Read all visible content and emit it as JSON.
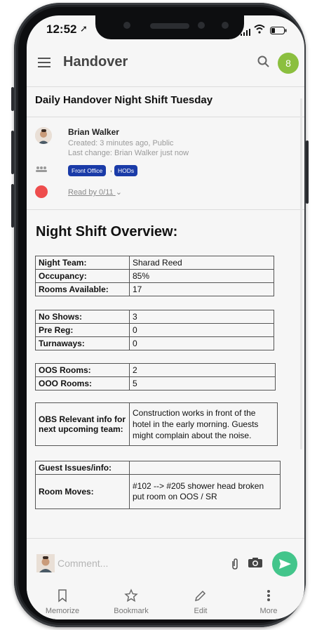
{
  "status": {
    "time": "12:52",
    "signal": "..ll ≋"
  },
  "appbar": {
    "title": "Handover",
    "badge": "8"
  },
  "document": {
    "title": "Daily Handover Night Shift Tuesday",
    "author": "Brian Walker",
    "created": "Created: 3 minutes ago, Public",
    "last_change": "Last change: Brian Walker just now",
    "tags": [
      "Front Office",
      "HODs"
    ],
    "read_by": "Read by 0/11"
  },
  "content": {
    "heading": "Night Shift Overview:",
    "table1": [
      {
        "k": "Night Team:",
        "v": "Sharad Reed"
      },
      {
        "k": "Occupancy:",
        "v": "85%"
      },
      {
        "k": "Rooms Available:",
        "v": "17"
      }
    ],
    "table2": [
      {
        "k": "No Shows:",
        "v": "3"
      },
      {
        "k": "Pre Reg:",
        "v": "0"
      },
      {
        "k": "Turnaways:",
        "v": "0"
      }
    ],
    "table3": [
      {
        "k": "OOS Rooms:",
        "v": "2"
      },
      {
        "k": "OOO Rooms:",
        "v": "5"
      }
    ],
    "table4": {
      "k": "OBS Relevant info for next upcoming team:",
      "v": "Construction works in front of the hotel in the early  morning. Guests  might complain about the noise."
    },
    "table5": [
      {
        "k": "Guest Issues/info:",
        "v": ""
      },
      {
        "k": "Room Moves:",
        "v": "#102 --> #205 shower head broken put room on OOS / SR"
      }
    ]
  },
  "composer": {
    "placeholder": "Comment..."
  },
  "nav": [
    {
      "label": "Memorize",
      "icon": "bookmark-outline-icon"
    },
    {
      "label": "Bookmark",
      "icon": "star-icon"
    },
    {
      "label": "Edit",
      "icon": "pencil-icon"
    },
    {
      "label": "More",
      "icon": "more-vertical-icon"
    }
  ],
  "colors": {
    "accent_green": "#43c58b",
    "badge_green": "#8bbf3f",
    "tag_blue": "#1a3ba8",
    "unread_red": "#ee4d4d"
  }
}
